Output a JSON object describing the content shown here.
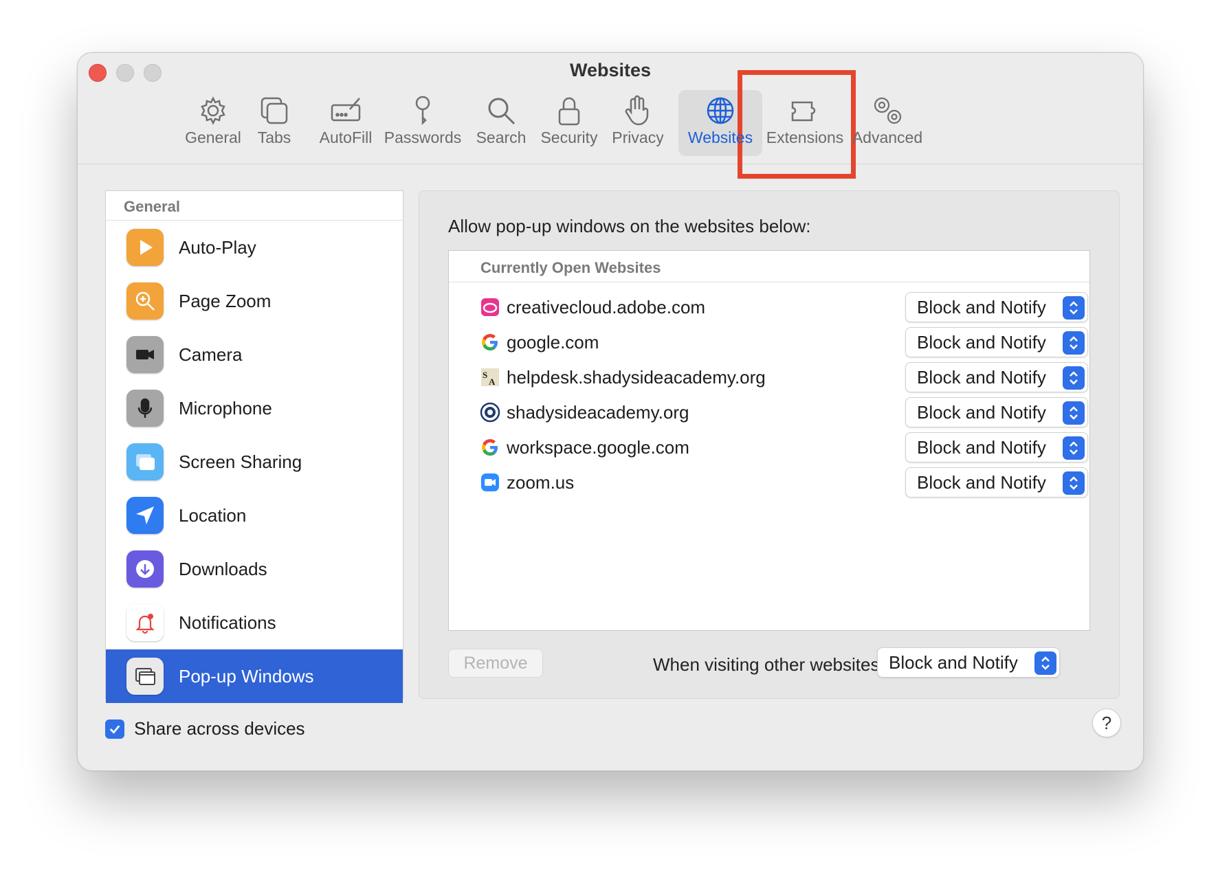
{
  "window": {
    "title": "Websites"
  },
  "toolbar": {
    "items": [
      {
        "label": "General",
        "icon": "gear-icon"
      },
      {
        "label": "Tabs",
        "icon": "tabs-icon"
      },
      {
        "label": "AutoFill",
        "icon": "autofill-icon"
      },
      {
        "label": "Passwords",
        "icon": "key-icon"
      },
      {
        "label": "Search",
        "icon": "search-icon"
      },
      {
        "label": "Security",
        "icon": "lock-icon"
      },
      {
        "label": "Privacy",
        "icon": "hand-icon"
      },
      {
        "label": "Websites",
        "icon": "globe-icon",
        "selected": true
      },
      {
        "label": "Extensions",
        "icon": "puzzle-icon"
      },
      {
        "label": "Advanced",
        "icon": "gears-icon"
      }
    ]
  },
  "sidebar": {
    "header": "General",
    "items": [
      {
        "label": "Auto-Play",
        "icon": "play-icon",
        "color": "#f2a33a"
      },
      {
        "label": "Page Zoom",
        "icon": "zoom-icon",
        "color": "#f2a33a"
      },
      {
        "label": "Camera",
        "icon": "camera-icon",
        "color": "#9a9a9a"
      },
      {
        "label": "Microphone",
        "icon": "microphone-icon",
        "color": "#9a9a9a"
      },
      {
        "label": "Screen Sharing",
        "icon": "screen-sharing-icon",
        "color": "#5ab5f5"
      },
      {
        "label": "Location",
        "icon": "location-icon",
        "color": "#2f7bf0"
      },
      {
        "label": "Downloads",
        "icon": "download-icon",
        "color": "#6a5ae0"
      },
      {
        "label": "Notifications",
        "icon": "bell-icon",
        "color": "#ffffff"
      },
      {
        "label": "Pop-up Windows",
        "icon": "popup-windows-icon",
        "color": "#8a8a8a",
        "selected": true
      }
    ]
  },
  "main": {
    "prompt": "Allow pop-up windows on the websites below:",
    "list_header": "Currently Open Websites",
    "sites": [
      {
        "name": "creativecloud.adobe.com",
        "setting": "Block and Notify",
        "icon": "adobe-cc-icon"
      },
      {
        "name": "google.com",
        "setting": "Block and Notify",
        "icon": "google-icon"
      },
      {
        "name": "helpdesk.shadysideacademy.org",
        "setting": "Block and Notify",
        "icon": "sa-icon"
      },
      {
        "name": "shadysideacademy.org",
        "setting": "Block and Notify",
        "icon": "seal-icon"
      },
      {
        "name": "workspace.google.com",
        "setting": "Block and Notify",
        "icon": "google-icon"
      },
      {
        "name": "zoom.us",
        "setting": "Block and Notify",
        "icon": "zoom-video-icon"
      }
    ],
    "remove_label": "Remove",
    "other_label": "When visiting other websites:",
    "other_value": "Block and Notify"
  },
  "footer": {
    "share_label": "Share across devices",
    "share_checked": true,
    "help_label": "?"
  }
}
